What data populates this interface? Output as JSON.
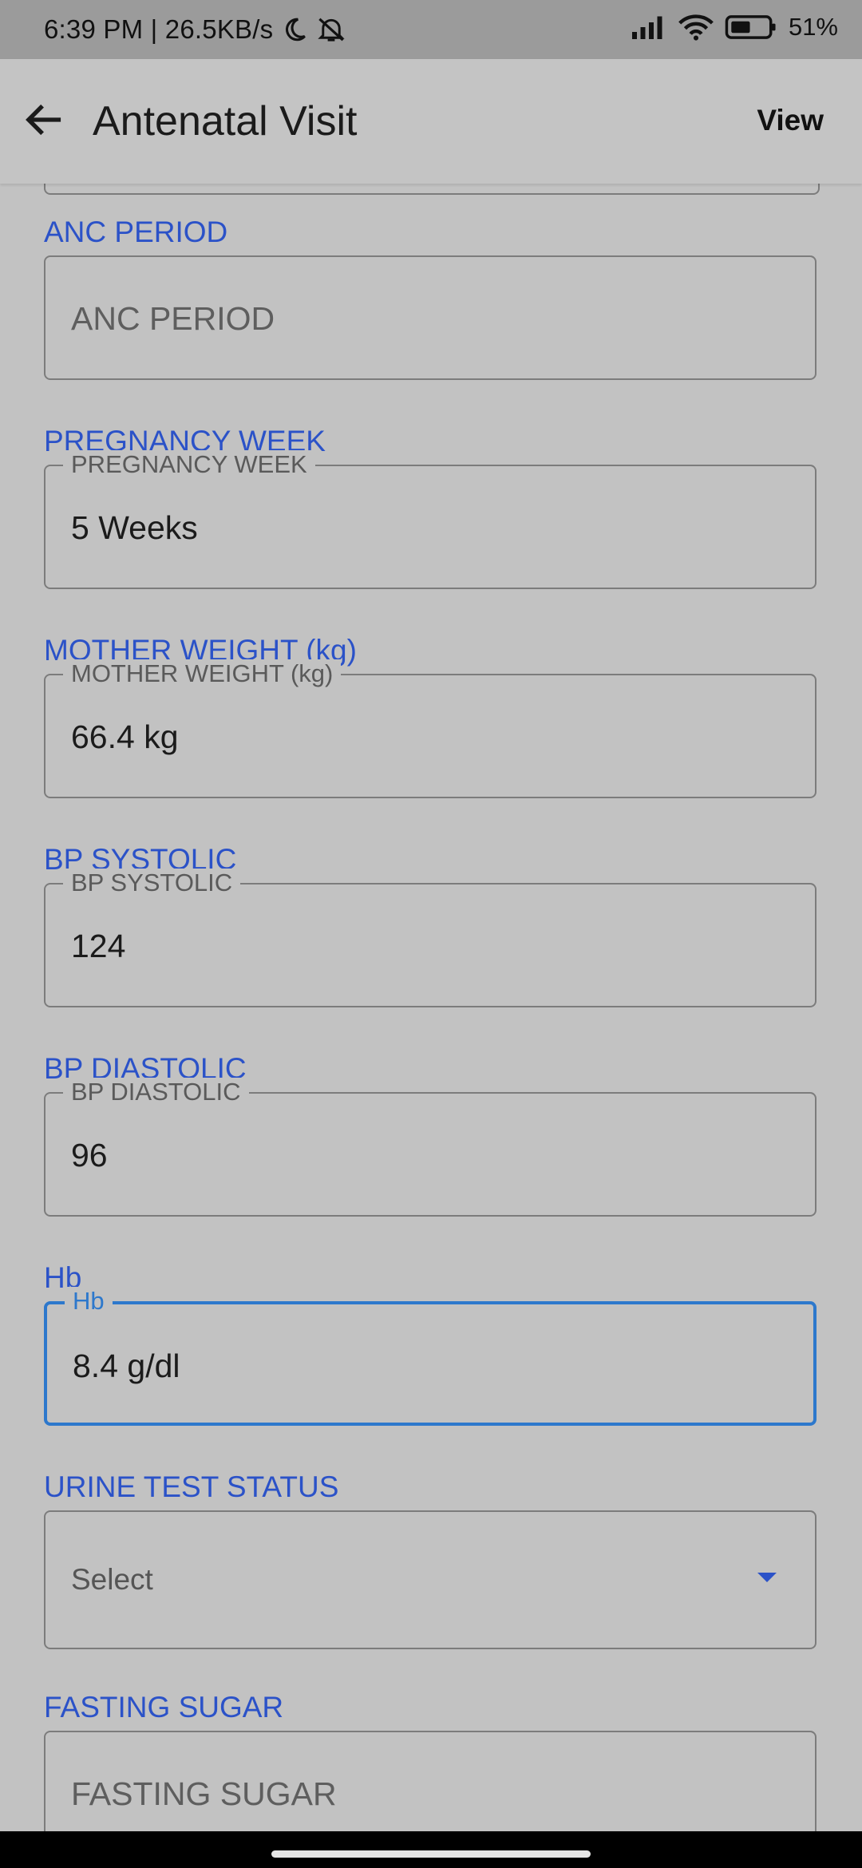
{
  "status_bar": {
    "left_text": "6:39 PM | 26.5KB/s",
    "battery_percent": "51%",
    "icons": [
      "moon-icon",
      "muted-bell-icon",
      "signal-icon",
      "wifi-icon",
      "battery-icon"
    ]
  },
  "app_bar": {
    "title": "Antenatal Visit",
    "action_label": "View",
    "back_icon": "arrow-back-icon"
  },
  "colors": {
    "label_blue": "#2b52c8",
    "focus_blue": "#2d78cc",
    "background": "#c2c2c2"
  },
  "fields": [
    {
      "label": "ANC PERIOD",
      "placeholder": "ANC PERIOD"
    },
    {
      "label": "PREGNANCY WEEK",
      "legend": "PREGNANCY WEEK",
      "value": "5 Weeks"
    },
    {
      "label": "MOTHER WEIGHT (kg)",
      "legend": "MOTHER WEIGHT (kg)",
      "value": "66.4 kg"
    },
    {
      "label": "BP SYSTOLIC",
      "legend": "BP SYSTOLIC",
      "value": "124"
    },
    {
      "label": "BP DIASTOLIC",
      "legend": "BP DIASTOLIC",
      "value": "96"
    },
    {
      "label": "Hb",
      "legend": "Hb",
      "value": "8.4 g/dl"
    },
    {
      "label": "URINE TEST STATUS",
      "selected": "Select"
    },
    {
      "label": "FASTING SUGAR",
      "placeholder": "FASTING SUGAR"
    }
  ]
}
